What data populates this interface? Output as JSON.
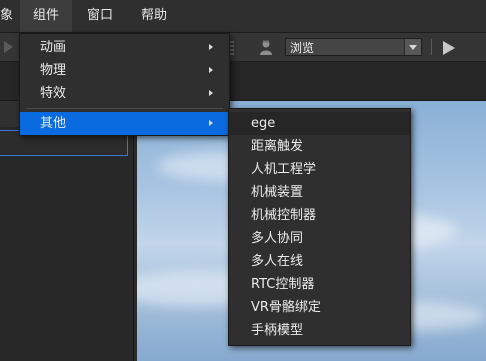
{
  "menubar": {
    "items": [
      "象",
      "组件",
      "窗口",
      "帮助"
    ]
  },
  "toolbar": {
    "view_mode": "浏览"
  },
  "component_menu": {
    "items": [
      {
        "label": "动画",
        "submenu": true
      },
      {
        "label": "物理",
        "submenu": true
      },
      {
        "label": "特效",
        "submenu": true
      },
      {
        "label": "其他",
        "submenu": true,
        "highlighted": true
      }
    ]
  },
  "other_submenu": {
    "items": [
      "ege",
      "距离触发",
      "人机工程学",
      "机械装置",
      "机械控制器",
      "多人协同",
      "多人在线",
      "RTC控制器",
      "VR骨骼绑定",
      "手柄模型"
    ]
  },
  "colors": {
    "highlight": "#0a6be0",
    "menu_bg": "#2f2f2f"
  }
}
